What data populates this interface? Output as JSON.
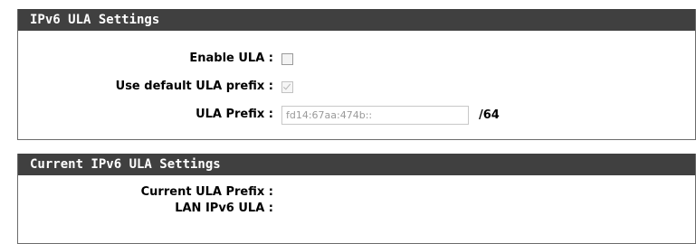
{
  "ula_settings": {
    "title": "IPv6 ULA Settings",
    "enable_ula_label": "Enable ULA :",
    "enable_ula_checked": false,
    "use_default_prefix_label": "Use default ULA prefix :",
    "use_default_prefix_checked": true,
    "ula_prefix_label": "ULA Prefix :",
    "ula_prefix_value": "fd14:67aa:474b::",
    "ula_prefix_suffix": "/64"
  },
  "current_settings": {
    "title": "Current IPv6 ULA Settings",
    "current_prefix_label": "Current ULA Prefix :",
    "current_prefix_value": "",
    "lan_ipv6_ula_label": "LAN IPv6 ULA :",
    "lan_ipv6_ula_value": ""
  }
}
